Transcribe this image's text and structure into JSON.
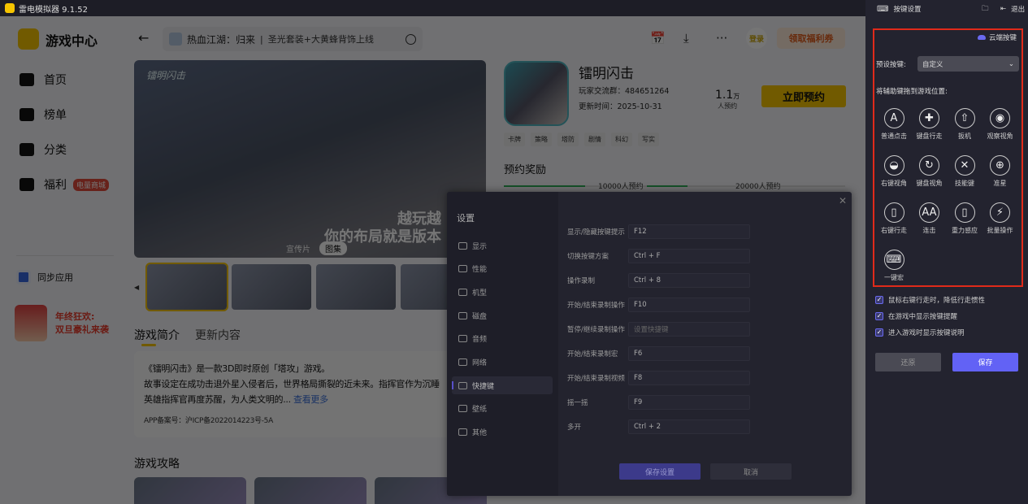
{
  "app": {
    "title": "雷电模拟器 9.1.52"
  },
  "sidebar": {
    "title": "游戏中心",
    "items": [
      {
        "label": "首页"
      },
      {
        "label": "榜单"
      },
      {
        "label": "分类"
      },
      {
        "label": "福利",
        "badge": "电量商城"
      }
    ],
    "sync": "同步应用",
    "promo": {
      "line1": "年终狂欢:",
      "line2": "双旦豪礼来袭"
    }
  },
  "search": {
    "game": "热血江湖：归来",
    "sub": "圣光套装+大黄蜂背饰上线"
  },
  "header": {
    "login": "登录",
    "coupon": "领取福利券"
  },
  "banner": {
    "logo": "镭明闪击",
    "slogan1": "越玩越",
    "slogan2": "你的布局就是版本",
    "tabs": [
      "宣传片",
      "图集"
    ]
  },
  "game": {
    "name": "镭明闪击",
    "group": "玩家交流群：484651264",
    "updated": "更新时间：2025-10-31",
    "count": "1.1",
    "count_unit": "万",
    "count_label": "人预约",
    "reserve": "立即预约",
    "tags": [
      "卡牌",
      "策略",
      "塔防",
      "剧情",
      "科幻",
      "写实"
    ],
    "reward_title": "预约奖励",
    "milestones": [
      "10000人预约",
      "20000人预约"
    ]
  },
  "tabs": {
    "intro": "游戏简介",
    "update": "更新内容"
  },
  "description": {
    "line1": "《镭明闪击》是一款3D即时原创「塔攻」游戏。",
    "line2": "故事设定在成功击退外星入侵者后，世界格局撕裂的近未来。指挥官作为沉睡",
    "line3": "英雄指挥官再度苏醒，为人类文明的...",
    "more": "查看更多",
    "icp": "APP备案号：沪ICP备2022014223号-5A"
  },
  "guide": {
    "title": "游戏攻略"
  },
  "settings": {
    "title": "设置",
    "nav": [
      "显示",
      "性能",
      "机型",
      "磁盘",
      "音频",
      "网络",
      "快捷键",
      "壁纸",
      "其他"
    ],
    "active": "快捷键",
    "shortcuts": [
      {
        "label": "显示/隐藏按键提示",
        "value": "F12"
      },
      {
        "label": "切换按键方案",
        "value": "Ctrl + F"
      },
      {
        "label": "操作录制",
        "value": "Ctrl + 8"
      },
      {
        "label": "开始/结束录制操作",
        "value": "F10"
      },
      {
        "label": "暂停/继续录制操作",
        "placeholder": "设置快捷键"
      },
      {
        "label": "开始/结束录制宏",
        "value": "F6"
      },
      {
        "label": "开始/结束录制视频",
        "value": "F8"
      },
      {
        "label": "摇一摇",
        "value": "F9"
      },
      {
        "label": "多开",
        "value": "Ctrl + 2"
      }
    ],
    "save": "保存设置",
    "cancel": "取消"
  },
  "keymap": {
    "title": "按键设置",
    "exit": "退出",
    "cloud": "云端按键",
    "preset_label": "预设按键:",
    "preset_value": "自定义",
    "drag_hint": "将辅助键拖到游戏位置:",
    "keys": [
      {
        "label": "普通点击",
        "glyph": "A"
      },
      {
        "label": "键盘行走",
        "glyph": "✚"
      },
      {
        "label": "扳机",
        "glyph": "⇧"
      },
      {
        "label": "观察视角",
        "glyph": "◉"
      },
      {
        "label": "右键视角",
        "glyph": "◒"
      },
      {
        "label": "键盘视角",
        "glyph": "↻"
      },
      {
        "label": "技能键",
        "glyph": "✕"
      },
      {
        "label": "准星",
        "glyph": "⊕"
      },
      {
        "label": "右键行走",
        "glyph": "▯"
      },
      {
        "label": "连击",
        "glyph": "AA"
      },
      {
        "label": "重力感应",
        "glyph": "▯"
      },
      {
        "label": "批量操作",
        "glyph": "⚡"
      },
      {
        "label": "一键宏",
        "glyph": "⌨"
      }
    ],
    "options": [
      "鼠标右键行走时，降低行走惯性",
      "在游戏中显示按键提醒",
      "进入游戏时显示按键说明"
    ],
    "restore": "还原",
    "save": "保存"
  },
  "colors": {
    "accent": "#6262f5",
    "highlight_border": "#e02a1a",
    "yellow": "#f5c400"
  }
}
